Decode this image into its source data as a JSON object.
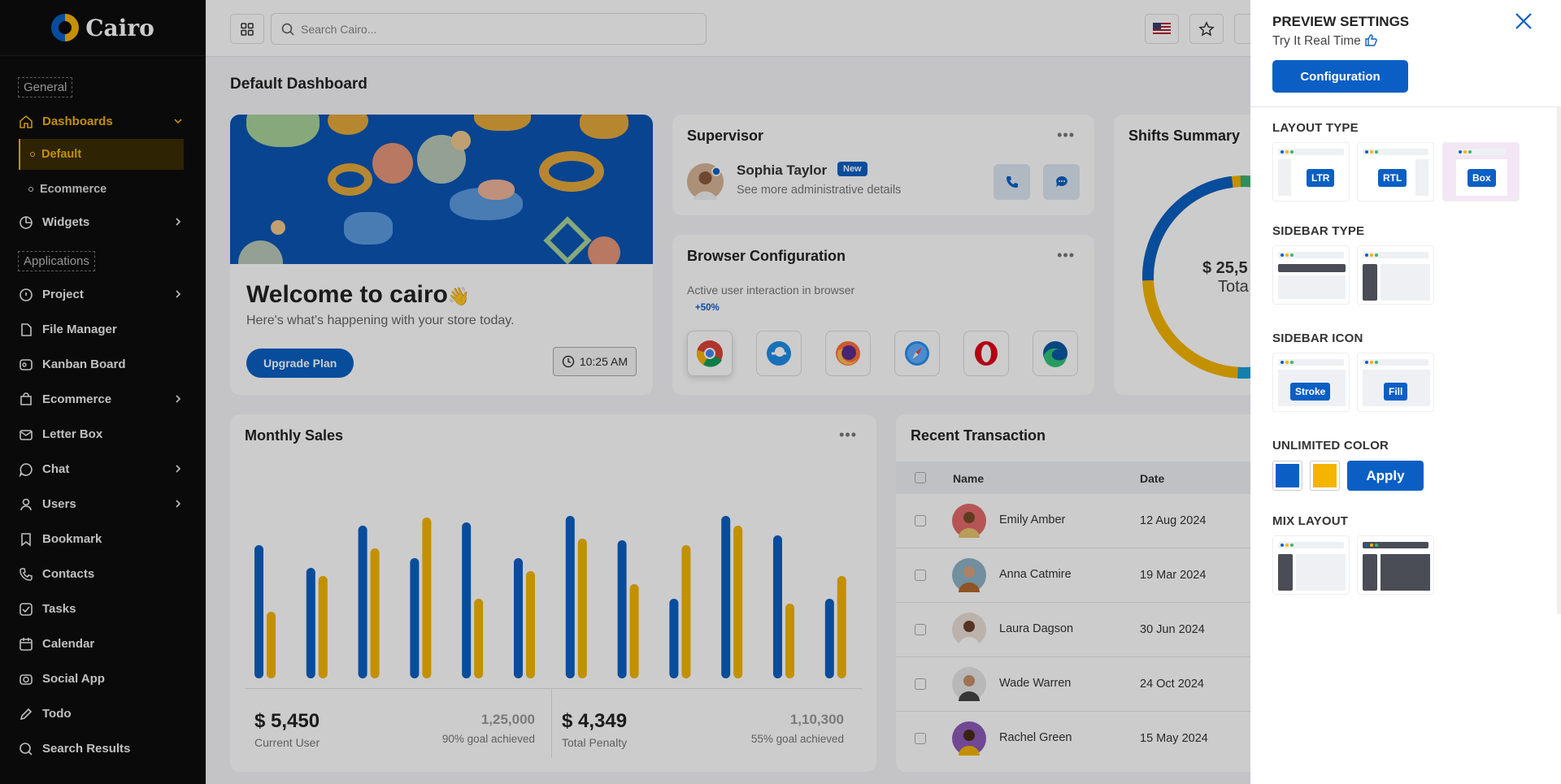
{
  "app": {
    "name": "Cairo"
  },
  "sidebar": {
    "section_general": "General",
    "section_applications": "Applications",
    "dashboards": "Dashboards",
    "sub_default": "Default",
    "sub_ecommerce": "Ecommerce",
    "widgets": "Widgets",
    "items": [
      "Project",
      "File Manager",
      "Kanban Board",
      "Ecommerce",
      "Letter Box",
      "Chat",
      "Users",
      "Bookmark",
      "Contacts",
      "Tasks",
      "Calendar",
      "Social App",
      "Todo",
      "Search Results"
    ]
  },
  "topbar": {
    "search_placeholder": "Search Cairo..."
  },
  "page": {
    "title": "Default Dashboard"
  },
  "welcome": {
    "title": "Welcome to cairo",
    "wave": "👋",
    "subtitle": "Here's what's happening with your store today.",
    "upgrade": "Upgrade Plan",
    "time": "10:25 AM"
  },
  "supervisor": {
    "title": "Supervisor",
    "name": "Sophia Taylor",
    "badge": "New",
    "desc": "See more administrative details"
  },
  "browser": {
    "title": "Browser Configuration",
    "subtitle": "Active user interaction in browser",
    "highlight": "+50%",
    "browsers": [
      "chrome-icon",
      "edge-legacy-icon",
      "firefox-icon",
      "safari-icon",
      "opera-icon",
      "edge-icon"
    ]
  },
  "shifts": {
    "title": "Shifts Summary",
    "value": "$ 25,5",
    "label": "Tota"
  },
  "monthly": {
    "title": "Monthly Sales",
    "kpi1": {
      "value": "$ 5,450",
      "label": "Current User",
      "number": "1,25,000",
      "goal": "90% goal achieved"
    },
    "kpi2": {
      "value": "$ 4,349",
      "label": "Total Penalty",
      "number": "1,10,300",
      "goal": "55% goal achieved"
    }
  },
  "chart_data": {
    "type": "bar",
    "series": [
      {
        "values": [
          0.82,
          0.68,
          0.94,
          0.74,
          0.96,
          0.74,
          1.0,
          0.85,
          0.49,
          1.0,
          0.88,
          0.49
        ]
      },
      {
        "values": [
          0.41,
          0.63,
          0.8,
          0.99,
          0.49,
          0.66,
          0.86,
          0.58,
          0.82,
          0.94,
          0.46,
          0.63
        ]
      }
    ],
    "colors": [
      "#0b5fc4",
      "#f4b400"
    ]
  },
  "recent": {
    "title": "Recent Transaction",
    "col_name": "Name",
    "col_date": "Date",
    "rows": [
      {
        "name": "Emily Amber",
        "date": "12 Aug 2024"
      },
      {
        "name": "Anna Catmire",
        "date": "19 Mar 2024"
      },
      {
        "name": "Laura Dagson",
        "date": "30 Jun 2024"
      },
      {
        "name": "Wade Warren",
        "date": "24 Oct 2024"
      },
      {
        "name": "Rachel Green",
        "date": "15 May 2024"
      }
    ]
  },
  "panel": {
    "title": "PREVIEW SETTINGS",
    "subtitle": "Try It Real Time",
    "config": "Configuration",
    "layout_type": "LAYOUT TYPE",
    "layout_ltr": "LTR",
    "layout_rtl": "RTL",
    "layout_box": "Box",
    "sidebar_type": "SIDEBAR TYPE",
    "sidebar_icon": "SIDEBAR ICON",
    "icon_stroke": "Stroke",
    "icon_fill": "Fill",
    "unlimited": "UNLIMITED COLOR",
    "apply": "Apply",
    "mix": "MIX LAYOUT",
    "colors": [
      "#0b5fc4",
      "#f4b400"
    ]
  }
}
